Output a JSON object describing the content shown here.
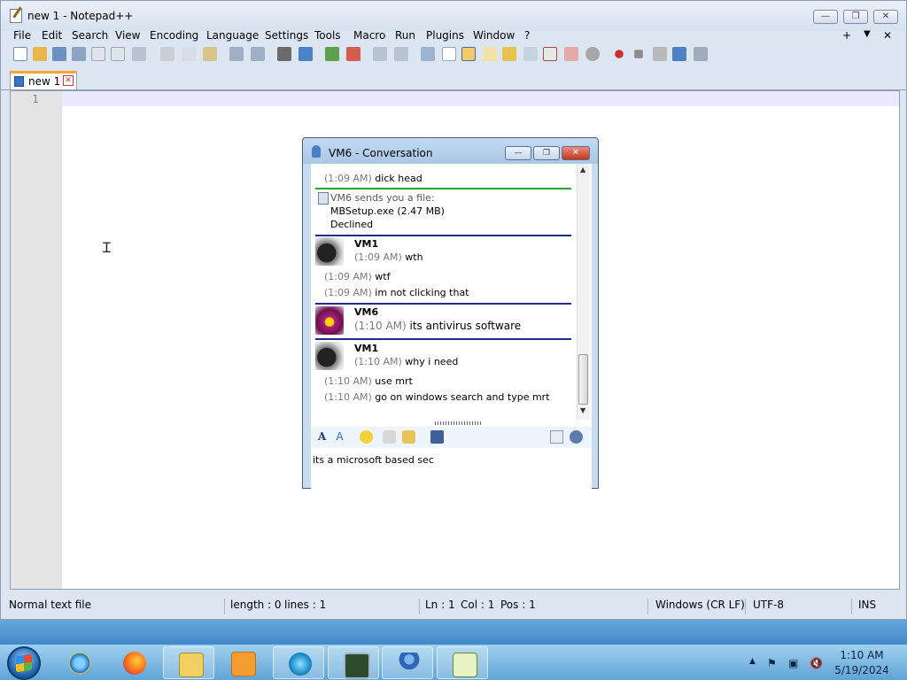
{
  "app": {
    "title": "new 1 - Notepad++",
    "controls": {
      "minimize": "—",
      "restore": "❐",
      "close": "✕"
    },
    "menu": [
      "File",
      "Edit",
      "Search",
      "View",
      "Encoding",
      "Language",
      "Settings",
      "Tools",
      "Macro",
      "Run",
      "Plugins",
      "Window",
      "?"
    ],
    "menu_right": {
      "plus": "+",
      "dropdown": "▼",
      "close": "✕"
    },
    "tab": {
      "label": "new 1",
      "close": "✕"
    },
    "editor": {
      "line_number": "1"
    },
    "status": {
      "doc_type": "Normal text file",
      "length": "length : 0",
      "lines": "lines : 1",
      "ln": "Ln : 1",
      "col": "Col : 1",
      "pos": "Pos : 1",
      "eol": "Windows (CR LF)",
      "encoding": "UTF-8",
      "mode": "INS"
    }
  },
  "conversation": {
    "title": "VM6 - Conversation",
    "controls": {
      "minimize": "—",
      "restore": "❐",
      "close": "✕"
    },
    "history": {
      "m1": {
        "time": "(1:09 AM)",
        "text": "dick head"
      },
      "file": {
        "header": "VM6 sends you a file:",
        "name": "MBSetup.exe (2.47 MB)",
        "status": "Declined"
      },
      "b1": {
        "user": "VM1",
        "time": "(1:09 AM)",
        "text": "wth"
      },
      "m2": {
        "time": "(1:09 AM)",
        "text": "wtf"
      },
      "m3": {
        "time": "(1:09 AM)",
        "text": "im not clicking that"
      },
      "b2": {
        "user": "VM6",
        "time": "(1:10 AM)",
        "text": "its antivirus software"
      },
      "b3": {
        "user": "VM1",
        "time": "(1:10 AM)",
        "text": "why i need"
      },
      "m4": {
        "time": "(1:10 AM)",
        "text": "use mrt"
      },
      "m5": {
        "time": "(1:10 AM)",
        "text": "go on windows search and type mrt"
      }
    },
    "input_text": "its a microsoft based sec"
  },
  "taskbar": {
    "clock_time": "1:10 AM",
    "clock_date": "5/19/2024"
  },
  "colors": {
    "tab_accent": "#f7a533",
    "divider_green": "#2aa52a",
    "divider_blue": "#1f2a8a"
  }
}
